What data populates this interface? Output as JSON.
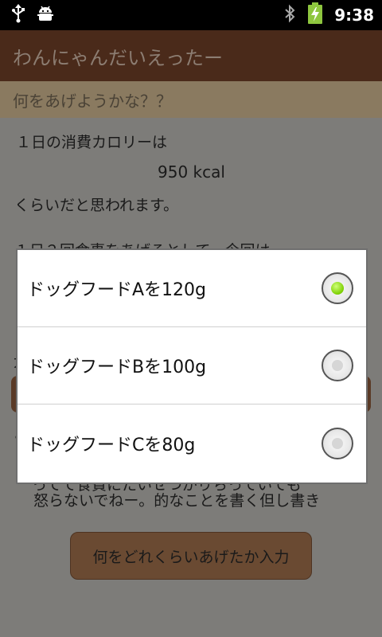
{
  "status_bar": {
    "time": "9:38"
  },
  "app": {
    "title": "わんにゃんだいえったー",
    "subtitle": "何をあげようかな？？"
  },
  "content": {
    "line1": "１日の消費カロリーは",
    "kcal": "950 kcal",
    "line2": "くらいだと思われます。",
    "line3_partial": "１日２回食事をあげるとして、今回は",
    "partial_a": "・",
    "partial_b": "ガ",
    "partial_c": "ぁ",
    "note_line1": "ってて食費にたいせつがりちっていても",
    "note_line2": "怒らないでねー。的なことを書く但し書き",
    "action_button": "何をどれくらいあげたか入力"
  },
  "dialog": {
    "options": [
      {
        "label": "ドッグフードAを120g",
        "checked": true
      },
      {
        "label": "ドッグフードBを100g",
        "checked": false
      },
      {
        "label": "ドッグフードCを80g",
        "checked": false
      }
    ]
  },
  "colors": {
    "accent_green": "#7ccf00",
    "titlebar": "#4a2a1a"
  }
}
